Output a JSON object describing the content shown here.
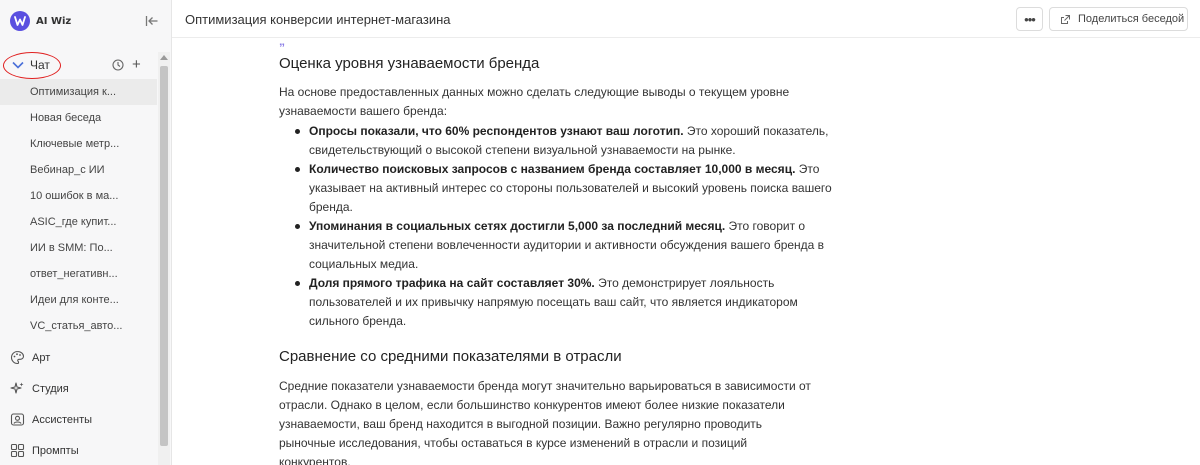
{
  "app": {
    "name": "AI Wiz"
  },
  "sidebar": {
    "chat_label": "Чат",
    "conversations": [
      "Оптимизация к...",
      "Новая беседа",
      "Ключевые метр...",
      "Вебинар_с ИИ",
      "10 ошибок в ма...",
      "ASIC_где купит...",
      "ИИ в SMM: По...",
      "ответ_негативн...",
      "Идеи для конте...",
      "VC_статья_авто..."
    ],
    "nav": [
      {
        "label": "Арт",
        "icon": "palette-icon"
      },
      {
        "label": "Студия",
        "icon": "sparkle-icon"
      },
      {
        "label": "Ассистенты",
        "icon": "assistant-icon"
      },
      {
        "label": "Промпты",
        "icon": "grid-icon"
      }
    ]
  },
  "topbar": {
    "title": "Оптимизация конверсии интернет-магазина",
    "more_label": "•••",
    "share_label": "Поделиться беседой"
  },
  "content": {
    "heading1": "Оценка уровня узнаваемости бренда",
    "intro": "На основе предоставленных данных можно сделать следующие выводы о текущем уровне узнаваемости вашего бренда:",
    "bullets": [
      {
        "bold": "Опросы показали, что 60% респондентов узнают ваш логотип.",
        "text": " Это хороший показатель, свидетельствующий о высокой степени визуальной узнаваемости на рынке."
      },
      {
        "bold": "Количество поисковых запросов с названием бренда составляет 10,000 в месяц.",
        "text": " Это указывает на активный интерес со стороны пользователей и высокий уровень поиска вашего бренда."
      },
      {
        "bold": "Упоминания в социальных сетях достигли 5,000 за последний месяц.",
        "text": " Это говорит о значительной степени вовлеченности аудитории и активности обсуждения вашего бренда в социальных медиа."
      },
      {
        "bold": "Доля прямого трафика на сайт составляет 30%.",
        "text": " Это демонстрирует лояльность пользователей и их привычку напрямую посещать ваш сайт, что является индикатором сильного бренда."
      }
    ],
    "heading2": "Сравнение со средними показателями в отрасли",
    "para2": "Средние показатели узнаваемости бренда могут значительно варьироваться в зависимости от отрасли. Однако в целом, если большинство конкурентов имеют более низкие показатели узнаваемости, ваш бренд находится в выгодной позиции. Важно регулярно проводить рыночные исследования, чтобы оставаться в курсе изменений в отрасли и позиций конкурентов."
  },
  "colors": {
    "accent": "#5a4fe0",
    "highlight_oval": "#e02020",
    "active_row": "#ebebeb"
  }
}
